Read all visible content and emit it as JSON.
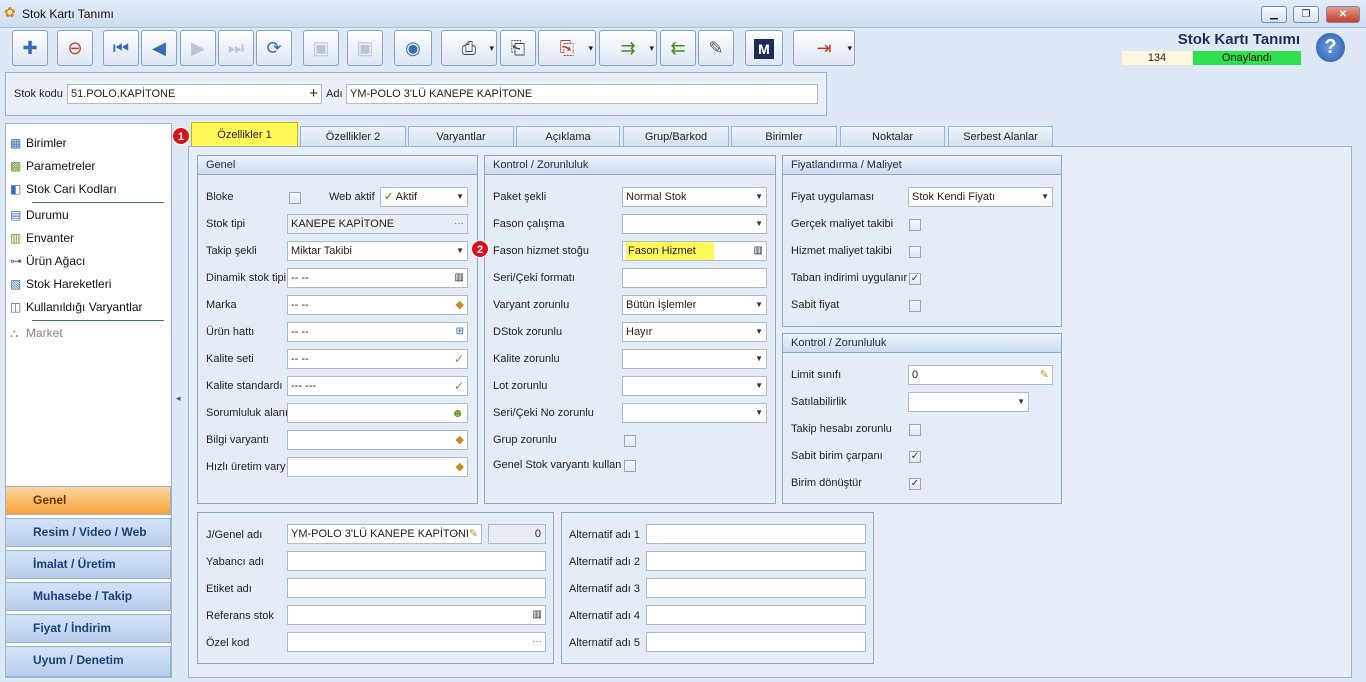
{
  "window": {
    "title": "Stok Kartı Tanımı",
    "min": "▁",
    "max": "❐",
    "close": "✕"
  },
  "header": {
    "title": "Stok Kartı Tanımı",
    "number": "134",
    "status": "Onaylandı",
    "help": "?"
  },
  "toolbar": {
    "logo": "M"
  },
  "stock": {
    "code_label": "Stok kodu",
    "code": "51.POLO.KAPİTONE",
    "name_label": "Adı",
    "name": "YM-POLO 3'LÜ KANEPE KAPİTONE"
  },
  "sidebar": {
    "items": [
      "Birimler",
      "Parametreler",
      "Stok Cari Kodları",
      "Durumu",
      "Envanter",
      "Ürün Ağacı",
      "Stok Hareketleri",
      "Kullanıldığı Varyantlar",
      "Market"
    ],
    "nav": [
      "Genel",
      "Resim / Video / Web",
      "İmalat / Üretim",
      "Muhasebe / Takip",
      "Fiyat / İndirim",
      "Uyum / Denetim"
    ]
  },
  "tabs": [
    "Özellikler 1",
    "Özellikler 2",
    "Varyantlar",
    "Açıklama",
    "Grup/Barkod",
    "Birimler",
    "Noktalar",
    "Serbest Alanlar"
  ],
  "markers": [
    "1",
    "2"
  ],
  "genel": {
    "title": "Genel",
    "bloke": "Bloke",
    "web_aktif": "Web aktif",
    "web_aktif_val": "Aktif",
    "stok_tipi": "Stok tipi",
    "stok_tipi_val": "KANEPE KAPİTONE",
    "takip_sekli": "Takip şekli",
    "takip_sekli_val": "Miktar Takibi",
    "dinamik": "Dinamik stok tipi",
    "dinamik_val": "-- --",
    "marka": "Marka",
    "marka_val": "-- --",
    "urun_hatti": "Ürün hattı",
    "urun_hatti_val": "-- --",
    "kalite_seti": "Kalite seti",
    "kalite_seti_val": "-- --",
    "kalite_std": "Kalite standardı",
    "kalite_std_val": "--- ---",
    "sorumluluk": "Sorumluluk alanı",
    "bilgi_varyanti": "Bilgi varyantı",
    "hizli_uretim": "Hızlı üretim vary"
  },
  "kontrol": {
    "title": "Kontrol / Zorunluluk",
    "paket": "Paket şekli",
    "paket_val": "Normal Stok",
    "fason": "Fason çalışma",
    "fason_hizmet": "Fason hizmet stoğu",
    "fason_hizmet_val": "Fason Hizmet",
    "seri_format": "Seri/Çeki formatı",
    "varyant_zor": "Varyant zorunlu",
    "varyant_zor_val": "Bütün İşlemler",
    "dstok": "DStok zorunlu",
    "dstok_val": "Hayır",
    "kalite_zor": "Kalite zorunlu",
    "lot_zor": "Lot zorunlu",
    "seri_no": "Seri/Çeki No zorunlu",
    "grup_zor": "Grup zorunlu",
    "genel_stok_var": "Genel Stok varyantı kullan"
  },
  "fiyat": {
    "title": "Fiyatlandırma / Maliyet",
    "uygulamasi": "Fiyat uygulaması",
    "uygulamasi_val": "Stok Kendi Fiyatı",
    "gercek": "Gerçek maliyet takibi",
    "hizmet": "Hizmet maliyet takibi",
    "taban": "Taban indirimi uygulanır",
    "sabit": "Sabit fiyat"
  },
  "kontrol2": {
    "title": "Kontrol / Zorunluluk",
    "limit": "Limit sınıfı",
    "limit_val": "0",
    "satilabilirlik": "Satılabilirlik",
    "takip_hesabi": "Takip hesabı zorunlu",
    "sabit_carpan": "Sabit birim çarpanı",
    "birim_donustur": "Birim dönüştür"
  },
  "names": {
    "genel_adi": "J/Genel adı",
    "genel_adi_val": "YM-POLO 3'LÜ KANEPE KAPİTONI",
    "count": "0",
    "yabanci": "Yabancı adı",
    "etiket": "Etiket adı",
    "referans": "Referans stok",
    "ozel": "Özel kod"
  },
  "alt": {
    "a1": "Alternatif adı 1",
    "a2": "Alternatif adı 2",
    "a3": "Alternatif adı 3",
    "a4": "Alternatif adı 4",
    "a5": "Alternatif adı 5"
  },
  "glyphs": {
    "dots": "···",
    "check": "✓",
    "plus": "+"
  },
  "colors": {
    "highlight": "#fff95a",
    "status_green": "#2ee04a",
    "marker_red": "#d8111b",
    "nav_active": "#f7a53d"
  }
}
